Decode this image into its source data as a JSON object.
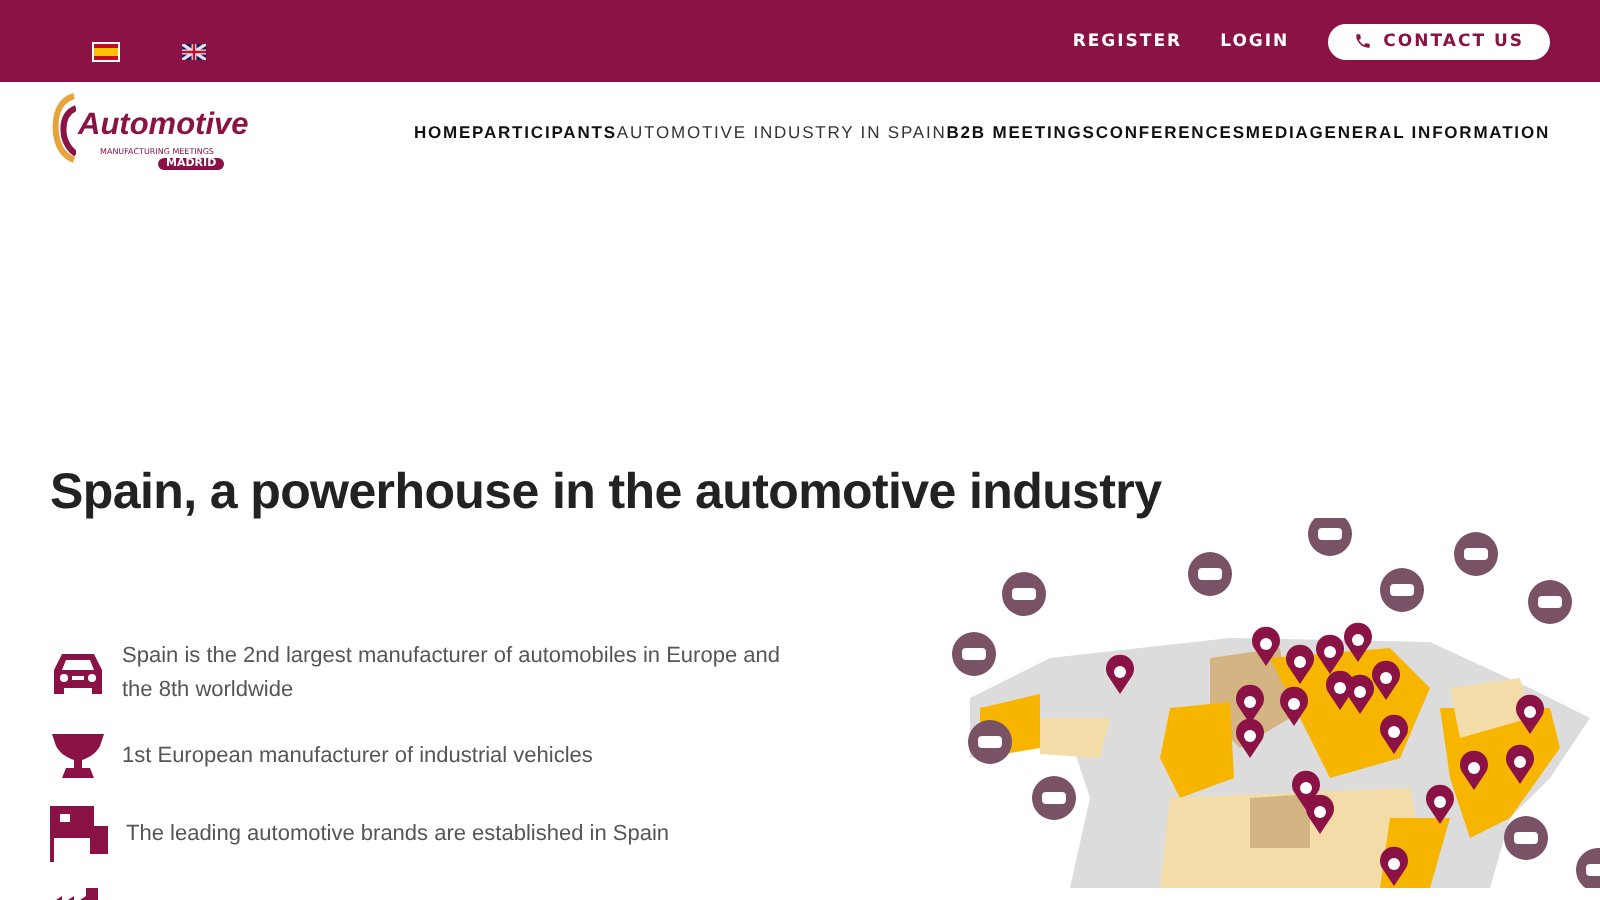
{
  "top_bar": {
    "languages": [
      {
        "kind": "es",
        "selected": true
      },
      {
        "kind": "en",
        "selected": false
      }
    ],
    "links": [
      "REGISTER",
      "LOGIN"
    ],
    "contact_button": "CONTACT US"
  },
  "header": {
    "logo": {
      "title": "Automotive",
      "subtitle": "MANUFACTURING MEETINGS",
      "badge": "MADRID"
    },
    "nav": [
      {
        "label": "HOME",
        "selected": false
      },
      {
        "label": "PARTICIPANTS",
        "selected": false
      },
      {
        "label": "AUTOMOTIVE INDUSTRY IN SPAIN",
        "selected": true
      },
      {
        "label": "B2B MEETINGS",
        "selected": false
      },
      {
        "label": "CONFERENCES",
        "selected": false
      },
      {
        "label": "MEDIA",
        "selected": false
      },
      {
        "label": "GENERAL INFORMATION",
        "selected": false
      }
    ]
  },
  "section": {
    "title": "Spain, a powerhouse in the automotive industry",
    "facts": [
      {
        "kind": "car",
        "text": "Spain is the 2nd largest manufacturer of automobiles in Europe and the 8th worldwide"
      },
      {
        "kind": "trophy",
        "text": "1st European manufacturer of industrial vehicles"
      },
      {
        "kind": "dealer",
        "text": "The leading automotive brands are established in Spain"
      },
      {
        "kind": "factory"
      }
    ]
  }
}
